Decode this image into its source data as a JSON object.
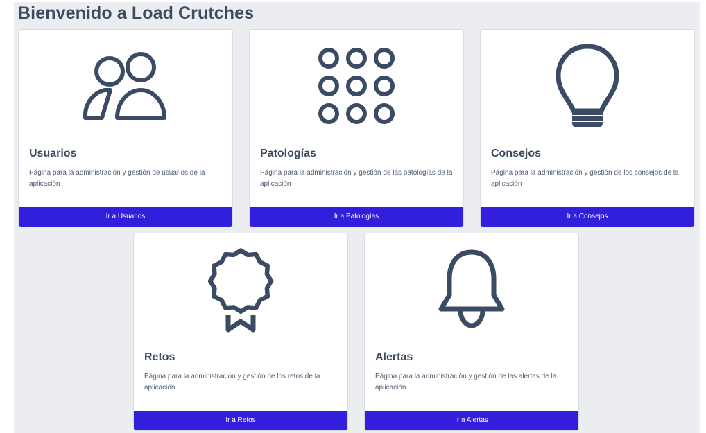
{
  "page": {
    "title": "Bienvenido a Load Crutches"
  },
  "colors": {
    "accent": "#321fdb",
    "icon": "#3c4b64",
    "background": "#ebedf0"
  },
  "cards": [
    {
      "icon": "users-icon",
      "title": "Usuarios",
      "description": "Página para la administración y gestión de usuarios de la aplicación",
      "button_label": "Ir a Usuarios"
    },
    {
      "icon": "grid-dots-icon",
      "title": "Patologías",
      "description": "Página para la administración y gestión de las patologías de la aplicación",
      "button_label": "Ir a Patologías"
    },
    {
      "icon": "lightbulb-icon",
      "title": "Consejos",
      "description": "Página para la administración y gestión de los consejos de la aplicación",
      "button_label": "Ir a Consejos"
    },
    {
      "icon": "award-icon",
      "title": "Retos",
      "description": "Página para la administración y gestión de los retos de la aplicación",
      "button_label": "Ir a Retos"
    },
    {
      "icon": "bell-icon",
      "title": "Alertas",
      "description": "Página para la administración y gestión de las alertas de la aplicación",
      "button_label": "Ir a Alertas"
    }
  ]
}
